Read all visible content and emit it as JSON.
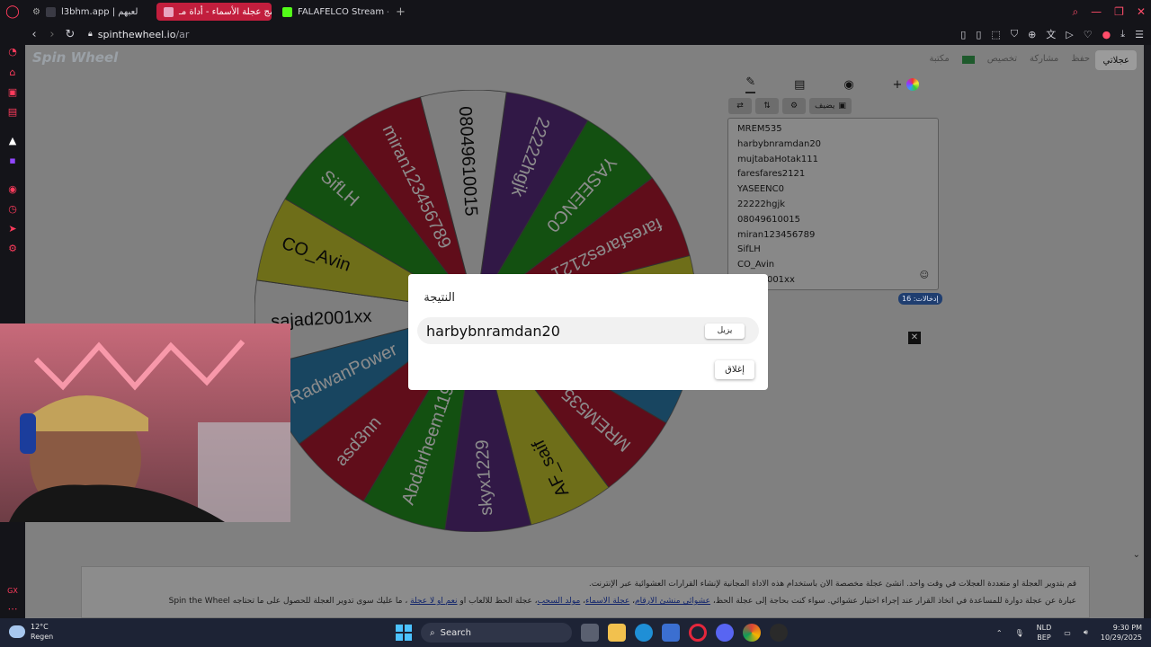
{
  "browser": {
    "tabs": [
      {
        "label": "l3bhm.app | لعبهم",
        "active": false,
        "favicon_color": "#3a3a44"
      },
      {
        "label": "برنامج عجلة الأسماء - أداة مـ",
        "active": true,
        "favicon_color": "#e8a4c0"
      },
      {
        "label": "FALAFELCO Stream - Wat",
        "active": false,
        "favicon_color": "#53fc18"
      }
    ],
    "new_tab": "+",
    "url_host": "spinthewheel.io",
    "url_path": "/ar"
  },
  "page": {
    "logo": "Spin Wheel",
    "header_links": [
      "حفظ",
      "مشاركة",
      "تخصيص",
      "مكتبة"
    ],
    "my_wheels": "عجلاتي",
    "entries_count": "إدخالات: 16",
    "add_button": "يضيف",
    "footer_line1": "قم بتدوير العجلة أو متعددة العجلات في وقت واحد. أنشئ عجلة مخصصة الآن باستخدام هذه الأداة المجانية لإنشاء القرارات العشوائية عبر الإنترنت.",
    "footer_line2_prefix": "عبارة عن عجلة دوارة للمساعدة في اتخاذ القرار عند إجراء اختيار عشوائي. سواء كنت بحاجة إلى عجلة الحظ،",
    "footer_link1": "عشوائي منشئ الأرقام",
    "footer_link2": "عجلة الأسماء",
    "footer_link3": "مولد السحب",
    "footer_line2_mid": "عجلة الحظ للألعاب أو",
    "footer_link4": "نعم أو لا عجلة",
    "footer_line2_suffix": "، ما عليك سوى تدوير العجلة للحصول على ما تحتاجه Spin the Wheel",
    "entries": [
      "MREM535",
      "harbybnramdan20",
      "mujtabaHotak111",
      "faresfares2121",
      "YASEENC0",
      "22222hgjk",
      "08049610015",
      "miran123456789",
      "SifLH",
      "CO_Avin",
      "sajad2001xx"
    ]
  },
  "dialog": {
    "title": "النتيجة",
    "result": "harbybnramdan20",
    "remove_label": "يزيل",
    "close_label": "إغلاق"
  },
  "taskbar": {
    "temp": "12°C",
    "condition": "Regen",
    "search": "Search",
    "lang1": "NLD",
    "lang2": "BEP",
    "time": "9:30 PM",
    "date": "10/29/2025"
  },
  "wheel": {
    "start_angle_deg": 8,
    "segments": [
      {
        "label": "22222hgjk",
        "color": "#5a2d80"
      },
      {
        "label": "YASEENC0",
        "color": "#239220"
      },
      {
        "label": "faresfares2121",
        "color": "#b01830"
      },
      {
        "label": "mujtabaHotak111",
        "color": "#c9c92e"
      },
      {
        "label": "harbybnramdan20",
        "color": "#2c7fb0"
      },
      {
        "label": "MREM535",
        "color": "#b01830"
      },
      {
        "label": "AF_saif",
        "color": "#c9c92e"
      },
      {
        "label": "skyx1229",
        "color": "#5a2d80"
      },
      {
        "label": "Abdalrheem119",
        "color": "#239220"
      },
      {
        "label": "asd3nn",
        "color": "#b01830"
      },
      {
        "label": "RadwanPower",
        "color": "#2c7fb0"
      },
      {
        "label": "sajad2001xx",
        "color": "#e6e6e6"
      },
      {
        "label": "CO_Avin",
        "color": "#c9c92e"
      },
      {
        "label": "SifLH",
        "color": "#239220"
      },
      {
        "label": "miran123456789",
        "color": "#b01830"
      },
      {
        "label": "08049610015",
        "color": "#e6e6e6"
      }
    ],
    "overlay_dim": 0.45
  }
}
